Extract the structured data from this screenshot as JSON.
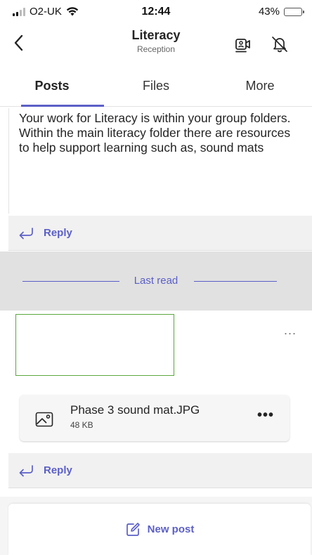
{
  "status_bar": {
    "carrier": "O2-UK",
    "time": "12:44",
    "battery_percent": "43%",
    "battery_level": 0.43
  },
  "header": {
    "title": "Literacy",
    "subtitle": "Reception",
    "icons": [
      "chevron-left-icon",
      "meet-now-icon",
      "bell-off-icon"
    ]
  },
  "tabs": [
    {
      "label": "Posts",
      "active": true
    },
    {
      "label": "Files",
      "active": false
    },
    {
      "label": "More",
      "active": false
    }
  ],
  "post1": {
    "lines": [
      "Your work for Literacy is within your group folders.",
      "Within the main literacy folder there are resources to help support learning such as, sound mats"
    ],
    "reply_label": "Reply"
  },
  "last_read_label": "Last read",
  "post2": {
    "more_label": "...",
    "attachment": {
      "name": "Phase 3 sound mat.JPG",
      "size": "48 KB",
      "more_label": "•••"
    },
    "reply_label": "Reply"
  },
  "new_post_label": "New post",
  "colors": {
    "accent": "#5b5fc7",
    "placeholder_border": "#5aa83e"
  }
}
